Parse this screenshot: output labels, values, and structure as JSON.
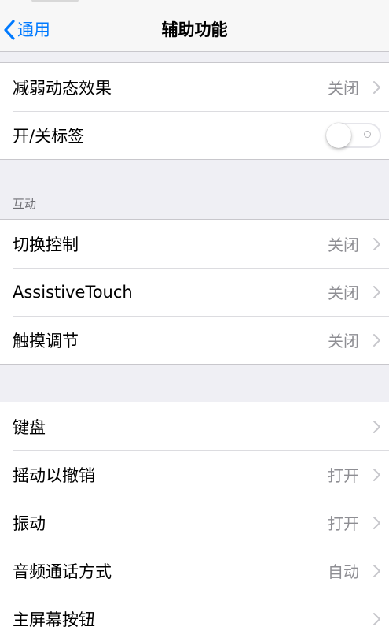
{
  "nav": {
    "back_label": "通用",
    "title": "辅助功能"
  },
  "group1": {
    "rows": [
      {
        "label": "减弱动态效果",
        "value": "关闭"
      },
      {
        "label": "开/关标签",
        "toggle_on": false
      }
    ]
  },
  "section_interaction": {
    "header": "互动",
    "rows": [
      {
        "label": "切换控制",
        "value": "关闭"
      },
      {
        "label": "AssistiveTouch",
        "value": "关闭"
      },
      {
        "label": "触摸调节",
        "value": "关闭"
      }
    ]
  },
  "group3": {
    "rows": [
      {
        "label": "键盘",
        "value": ""
      },
      {
        "label": "摇动以撤销",
        "value": "打开"
      },
      {
        "label": "振动",
        "value": "打开"
      },
      {
        "label": "音频通话方式",
        "value": "自动"
      },
      {
        "label": "主屏幕按钮",
        "value": ""
      }
    ]
  },
  "colors": {
    "accent": "#007aff",
    "background": "#efeff4",
    "secondary_text": "#8e8e93"
  }
}
